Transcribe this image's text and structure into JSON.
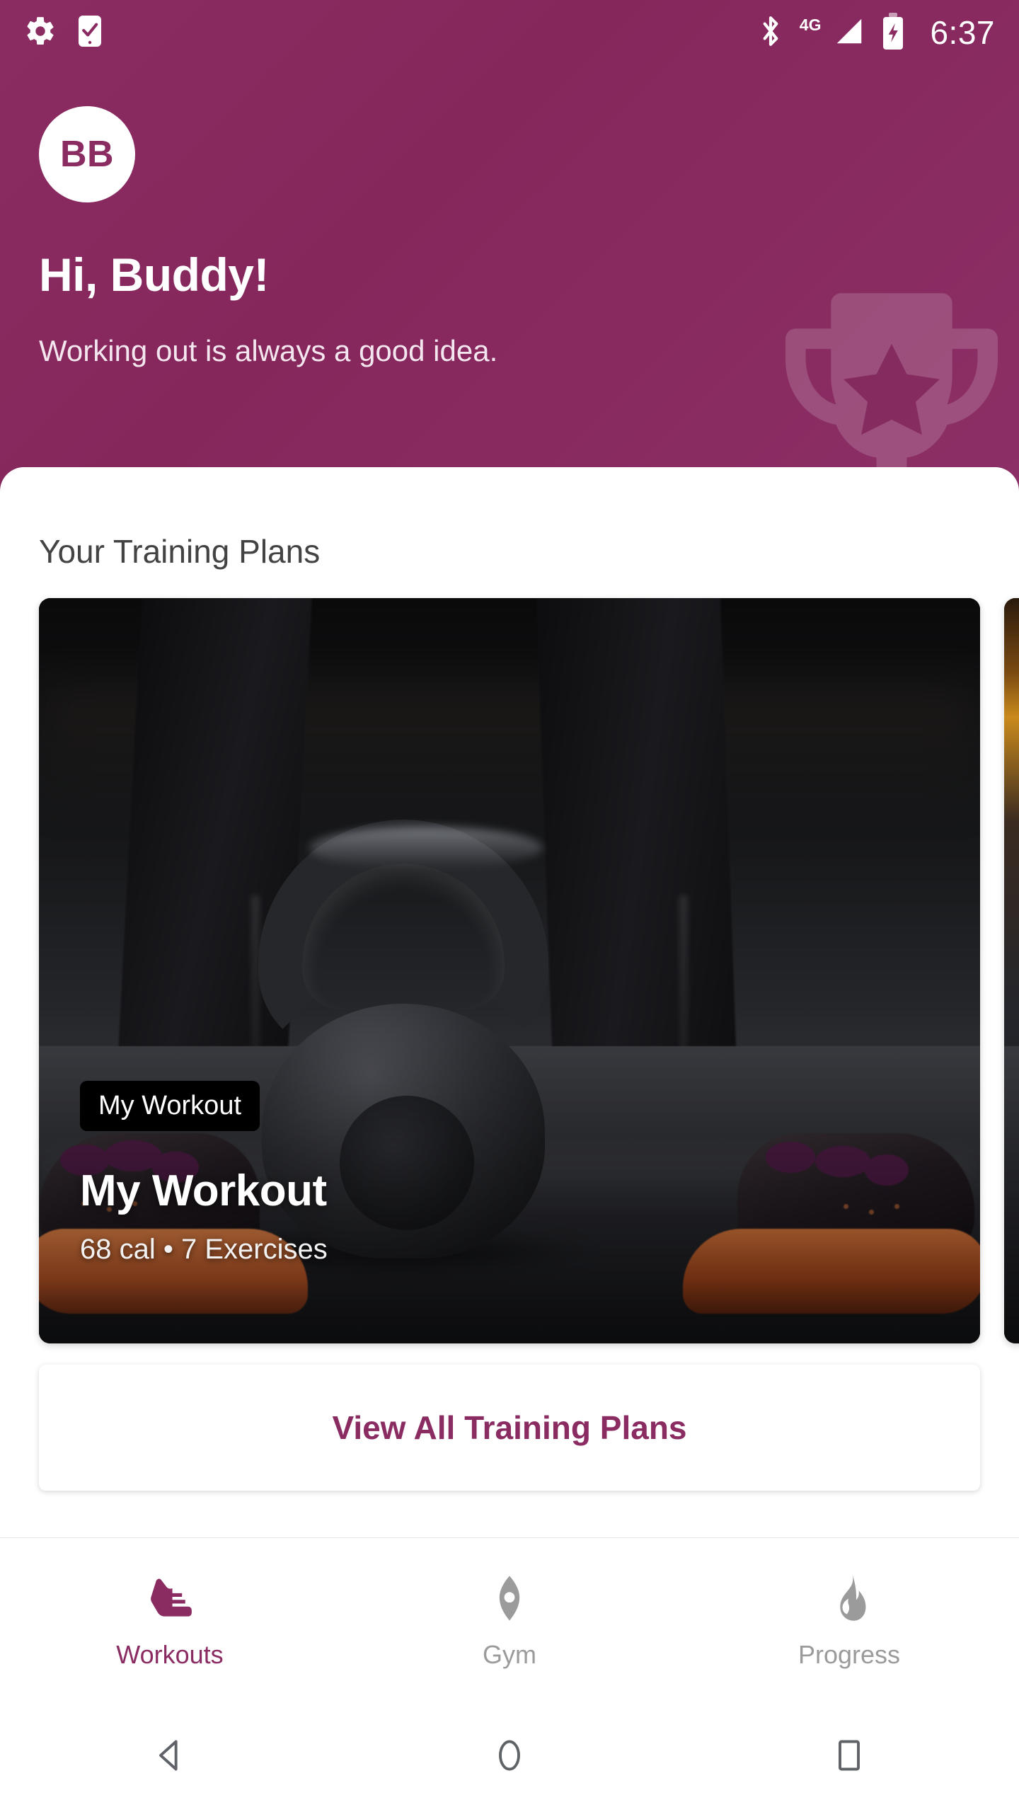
{
  "status_bar": {
    "time": "6:37",
    "network_label": "4G",
    "icons": [
      "gear-icon",
      "phone-check-icon",
      "bluetooth-icon",
      "signal-icon",
      "battery-charging-icon"
    ]
  },
  "header": {
    "avatar_initials": "BB",
    "greeting": "Hi, Buddy!",
    "subgreeting": "Working out is always a good idea.",
    "watermark_icon": "trophy-icon",
    "background_color": "#8a2c62"
  },
  "main": {
    "section_title": "Your Training Plans",
    "plans": [
      {
        "badge": "My Workout",
        "title": "My Workout",
        "subtitle": "68 cal • 7 Exercises",
        "calories": "68 cal",
        "exercises": "7 Exercises"
      },
      {
        "badge": "",
        "title": "",
        "subtitle": ""
      }
    ],
    "view_all_label": "View All Training Plans"
  },
  "tabbar": {
    "accent_color": "#8a2c62",
    "inactive_color": "#9b9b9b",
    "items": [
      {
        "label": "Workouts",
        "icon": "sneaker-icon",
        "active": true
      },
      {
        "label": "Gym",
        "icon": "location-pin-icon",
        "active": false
      },
      {
        "label": "Progress",
        "icon": "flame-icon",
        "active": false
      }
    ]
  },
  "system_nav": {
    "buttons": [
      {
        "name": "back-button",
        "icon": "triangle-back-icon"
      },
      {
        "name": "home-button",
        "icon": "circle-home-icon"
      },
      {
        "name": "recents-button",
        "icon": "square-recents-icon"
      }
    ]
  }
}
